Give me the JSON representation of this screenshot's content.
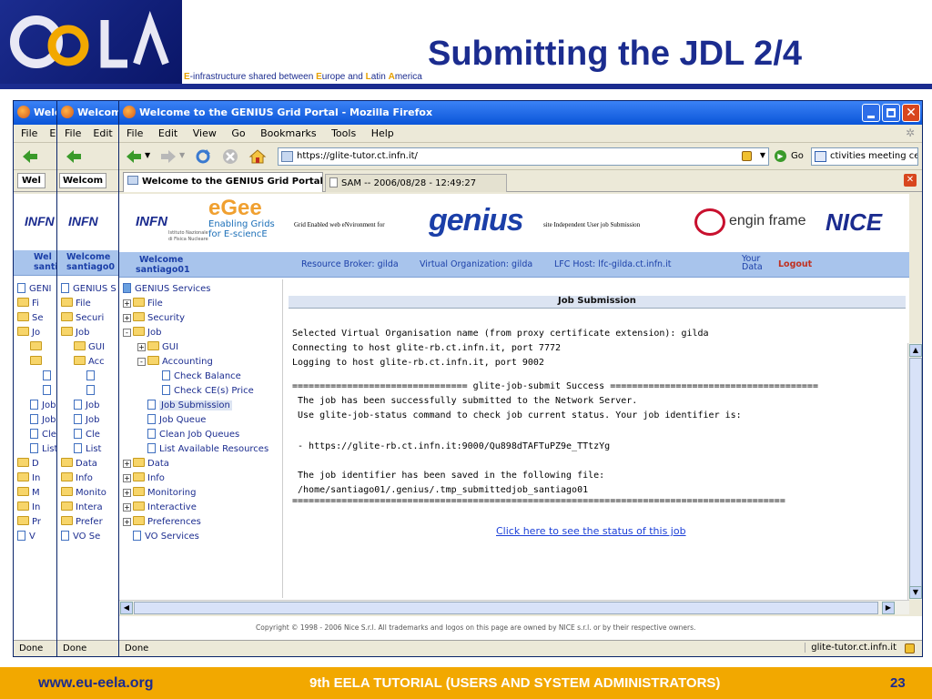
{
  "slide": {
    "logo_text": "ee la",
    "title": "Submitting the JDL 2/4",
    "subtitle": {
      "e": "E",
      "p1": "-infrastructure shared between ",
      "eu": "E",
      "p2": "urope and ",
      "la": "L",
      "p3": "atin ",
      "am": "A",
      "p4": "merica"
    },
    "footer_url": "www.eu-eela.org",
    "footer_event": "9th EELA TUTORIAL (USERS AND SYSTEM ADMINISTRATORS)",
    "page_number": "23"
  },
  "back_windows": {
    "title1": "Welc",
    "title2": "Welcom",
    "tab1": "Wel",
    "tab2": "Welcom",
    "welcome1": "Wel",
    "santi1": "santi",
    "welcome2": "Welcome",
    "santi2": "santiago0",
    "tree1": [
      "GENI",
      "Fi",
      "Se",
      "Jo",
      "",
      "",
      "",
      "",
      "Job",
      "Job",
      "Cle",
      "List",
      "D",
      "In",
      "M",
      "In",
      "Pr",
      "V"
    ],
    "tree2": [
      "GENIUS S",
      "File",
      "Securi",
      "Job",
      "GUI",
      "Acc",
      "",
      "",
      "Job",
      "Job",
      "Cle",
      "List",
      "Data",
      "Info",
      "Monito",
      "Intera",
      "Prefer",
      "VO Se"
    ],
    "menu1": [
      "File",
      "E"
    ],
    "menu2": [
      "File",
      "Edit"
    ],
    "status1": "Done",
    "status2": "Done"
  },
  "window": {
    "title": "Welcome to the GENIUS Grid Portal - Mozilla Firefox",
    "menu": [
      "File",
      "Edit",
      "View",
      "Go",
      "Bookmarks",
      "Tools",
      "Help"
    ],
    "url": "https://glite-tutor.ct.infn.it/",
    "go_label": "Go",
    "search_value": "ctivities meeting cern",
    "tabs": [
      "Welcome to the GENIUS Grid Portal",
      "SAM -- 2006/08/28 - 12:49:27"
    ],
    "status": "Done",
    "status_host": "glite-tutor.ct.infn.it"
  },
  "portal": {
    "logos": {
      "infn": "INFN",
      "infn_sub1": "Istituto Nazionale",
      "infn_sub2": "di Fisica Nucleare",
      "egee": "eGee",
      "egee_sub1": "Enabling Grids",
      "egee_sub2": "for E-sciencE",
      "genius_desc1": "Grid Enabled web eNvironment for",
      "genius": "genius",
      "genius_desc2": "site Independent User job Submission",
      "enginframe": "engin frame",
      "nice": "NICE"
    },
    "welcome": "Welcome",
    "user": "santiago01",
    "resource_broker": "Resource Broker: gilda",
    "virtual_org": "Virtual Organization: gilda",
    "lfc_host": "LFC Host: lfc-gilda.ct.infn.it",
    "your_data": "Your Data",
    "logout": "Logout",
    "tree": [
      {
        "label": "GENIUS Services",
        "kind": "root"
      },
      {
        "label": "File",
        "kind": "folder"
      },
      {
        "label": "Security",
        "kind": "folder"
      },
      {
        "label": "Job",
        "kind": "folder"
      },
      {
        "label": "GUI",
        "kind": "folder"
      },
      {
        "label": "Accounting",
        "kind": "folder"
      },
      {
        "label": "Check Balance",
        "kind": "doc"
      },
      {
        "label": "Check CE(s) Price",
        "kind": "doc"
      },
      {
        "label": "Job Submission",
        "kind": "doc"
      },
      {
        "label": "Job Queue",
        "kind": "doc"
      },
      {
        "label": "Clean Job Queues",
        "kind": "doc"
      },
      {
        "label": "List Available Resources",
        "kind": "doc"
      },
      {
        "label": "Data",
        "kind": "folder"
      },
      {
        "label": "Info",
        "kind": "folder"
      },
      {
        "label": "Monitoring",
        "kind": "folder"
      },
      {
        "label": "Interactive",
        "kind": "folder"
      },
      {
        "label": "Preferences",
        "kind": "folder"
      },
      {
        "label": "VO Services",
        "kind": "doc"
      }
    ],
    "section_title": "Job Submission",
    "lines": [
      "Selected Virtual Organisation name (from proxy certificate extension): gilda",
      "Connecting to host glite-rb.ct.infn.it, port 7772",
      "Logging to host glite-rb.ct.infn.it, port 9002",
      "================================ glite-job-submit Success ======================================",
      " The job has been successfully submitted to the Network Server.",
      " Use glite-job-status command to check job current status. Your job identifier is:",
      "",
      " - https://glite-rb.ct.infn.it:9000/Qu898dTAFTuPZ9e_TTtzYg",
      "",
      " The job identifier has been saved in the following file:",
      " /home/santiago01/.genius/.tmp_submittedjob_santiago01",
      "=========================================================================================="
    ],
    "status_link": "Click here to see the status of this job",
    "copyright": "Copyright © 1998 - 2006 Nice S.r.l. All trademarks and logos on this page are owned by NICE s.r.l. or by their respective owners."
  }
}
